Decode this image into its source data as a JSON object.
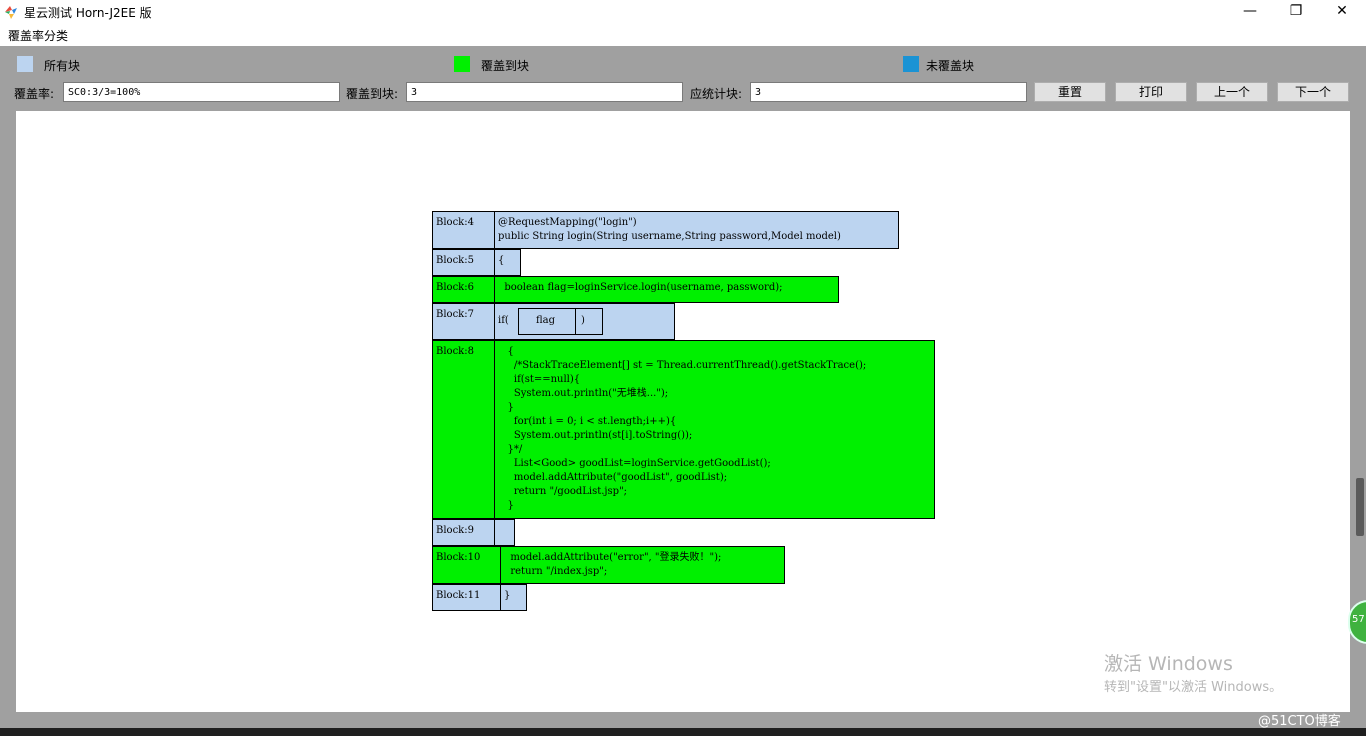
{
  "window": {
    "title": "星云测试 Horn-J2EE 版",
    "minimize_glyph": "—",
    "restore_glyph": "❐",
    "close_glyph": "✕"
  },
  "menu": {
    "items": [
      "覆盖率分类"
    ]
  },
  "legend": [
    {
      "label": "所有块",
      "color": "#bcd4f0"
    },
    {
      "label": "覆盖到块",
      "color": "#00f000"
    },
    {
      "label": "未覆盖块",
      "color": "#1b93d4"
    }
  ],
  "fields": {
    "coverage_label": "覆盖率:",
    "coverage_value": "SC0:3/3=100%",
    "covered_label": "覆盖到块:",
    "covered_value": "3",
    "total_label": "应统计块:",
    "total_value": "3"
  },
  "buttons": {
    "reset": "重置",
    "print": "打印",
    "prev": "上一个",
    "next": "下一个"
  },
  "blocks": [
    {
      "label": "Block:4",
      "status": "all",
      "code": "@RequestMapping(\"login\")\npublic String login(String username,String password,Model model)"
    },
    {
      "label": "Block:5",
      "status": "all",
      "code": "{"
    },
    {
      "label": "Block:6",
      "status": "covered",
      "code": "  boolean flag=loginService.login(username, password);"
    },
    {
      "label": "Block:7",
      "status": "all",
      "code": "if(",
      "cond": "flag",
      "close": ")"
    },
    {
      "label": "Block:8",
      "status": "covered",
      "code": "   {\n     /*StackTraceElement[] st = Thread.currentThread().getStackTrace();\n     if(st==null){\n     System.out.println(\"无堆栈...\");\n   }\n     for(int i = 0; i < st.length;i++){\n     System.out.println(st[i].toString());\n   }*/\n     List<Good> goodList=loginService.getGoodList();\n     model.addAttribute(\"goodList\", goodList);\n     return \"/goodList.jsp\";\n   }"
    },
    {
      "label": "Block:9",
      "status": "all",
      "code": ""
    },
    {
      "label": "Block:10",
      "status": "covered",
      "code": "  model.addAttribute(\"error\", \"登录失败！\");\n  return \"/index.jsp\";"
    },
    {
      "label": "Block:11",
      "status": "all",
      "code": "}"
    }
  ],
  "watermark": {
    "line1": "激活 Windows",
    "line2": "转到\"设置\"以激活 Windows。"
  },
  "corner_badge": "57",
  "blog_mark": "@51CTO博客"
}
